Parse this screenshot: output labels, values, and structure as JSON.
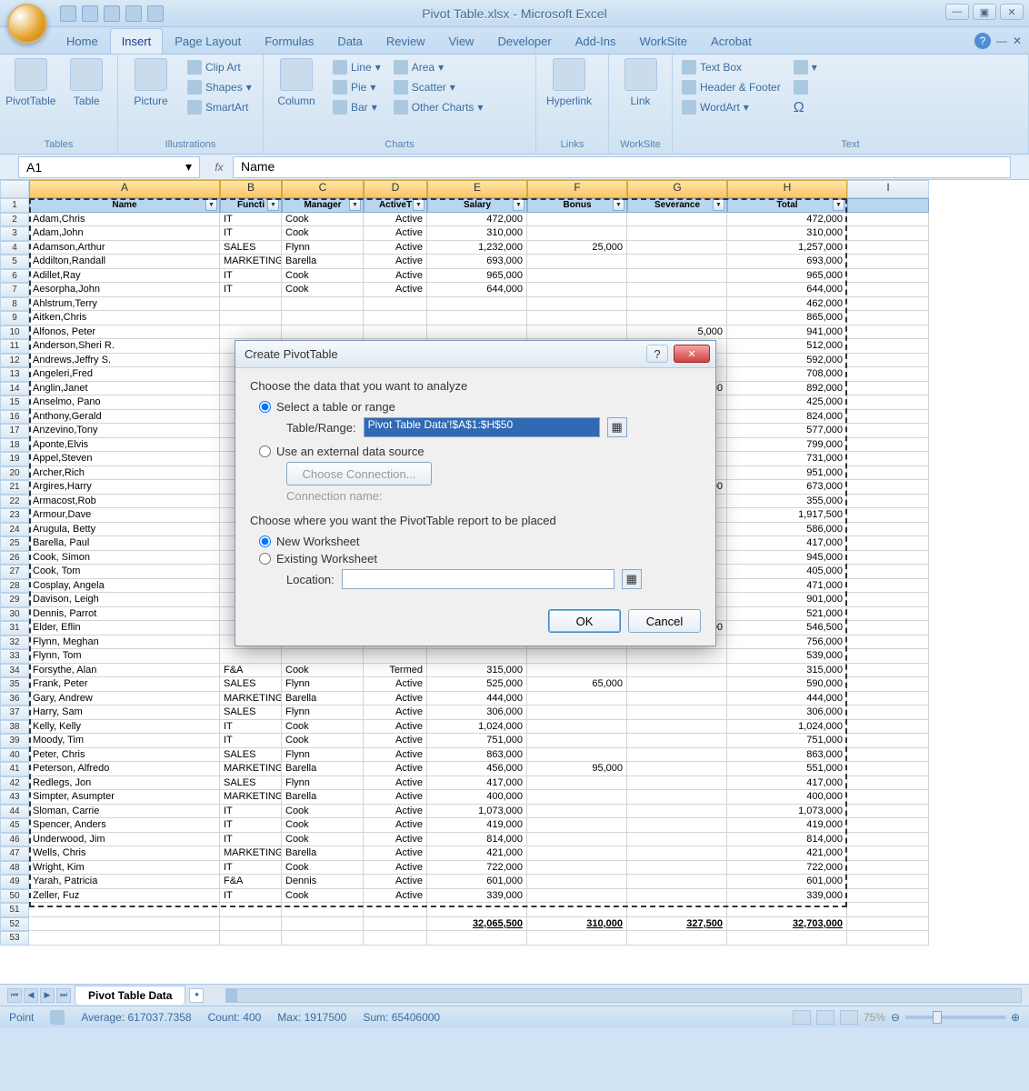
{
  "window": {
    "title": "Pivot Table.xlsx - Microsoft Excel"
  },
  "ribbon_tabs": [
    "Home",
    "Insert",
    "Page Layout",
    "Formulas",
    "Data",
    "Review",
    "View",
    "Developer",
    "Add-Ins",
    "WorkSite",
    "Acrobat"
  ],
  "ribbon": {
    "tables": {
      "pivot": "PivotTable",
      "table": "Table",
      "label": "Tables"
    },
    "illus": {
      "picture": "Picture",
      "clipart": "Clip Art",
      "shapes": "Shapes",
      "smartart": "SmartArt",
      "label": "Illustrations"
    },
    "charts": {
      "column": "Column",
      "line": "Line",
      "pie": "Pie",
      "bar": "Bar",
      "area": "Area",
      "scatter": "Scatter",
      "other": "Other Charts",
      "label": "Charts"
    },
    "links": {
      "hyperlink": "Hyperlink",
      "label": "Links"
    },
    "worksite": {
      "link": "Link",
      "label": "WorkSite"
    },
    "text": {
      "textbox": "Text Box",
      "header": "Header & Footer",
      "wordart": "WordArt",
      "label": "Text"
    }
  },
  "namebox": "A1",
  "fx": "fx",
  "formula": "Name",
  "columns": [
    "A",
    "B",
    "C",
    "D",
    "E",
    "F",
    "G",
    "H",
    "I"
  ],
  "headers": [
    "Name",
    "Functi",
    "Manager",
    "ActiveT",
    "Salary",
    "Bonus",
    "Severance",
    "Total"
  ],
  "rows": [
    {
      "n": "Adam,Chris",
      "f": "IT",
      "m": "Cook",
      "a": "Active",
      "s": "472,000",
      "b": "",
      "v": "",
      "t": "472,000"
    },
    {
      "n": "Adam,John",
      "f": "IT",
      "m": "Cook",
      "a": "Active",
      "s": "310,000",
      "b": "",
      "v": "",
      "t": "310,000"
    },
    {
      "n": "Adamson,Arthur",
      "f": "SALES",
      "m": "Flynn",
      "a": "Active",
      "s": "1,232,000",
      "b": "25,000",
      "v": "",
      "t": "1,257,000"
    },
    {
      "n": "Addilton,Randall",
      "f": "MARKETING",
      "m": "Barella",
      "a": "Active",
      "s": "693,000",
      "b": "",
      "v": "",
      "t": "693,000"
    },
    {
      "n": "Adillet,Ray",
      "f": "IT",
      "m": "Cook",
      "a": "Active",
      "s": "965,000",
      "b": "",
      "v": "",
      "t": "965,000"
    },
    {
      "n": "Aesorpha,John",
      "f": "IT",
      "m": "Cook",
      "a": "Active",
      "s": "644,000",
      "b": "",
      "v": "",
      "t": "644,000"
    },
    {
      "n": "Ahlstrum,Terry",
      "f": "",
      "m": "",
      "a": "",
      "s": "",
      "b": "",
      "v": "",
      "t": "462,000"
    },
    {
      "n": "Aitken,Chris",
      "f": "",
      "m": "",
      "a": "",
      "s": "",
      "b": "",
      "v": "",
      "t": "865,000"
    },
    {
      "n": "Alfonos, Peter",
      "f": "",
      "m": "",
      "a": "",
      "s": "",
      "b": "",
      "v": "5,000",
      "t": "941,000"
    },
    {
      "n": "Anderson,Sheri R.",
      "f": "",
      "m": "",
      "a": "",
      "s": "",
      "b": "",
      "v": "",
      "t": "512,000"
    },
    {
      "n": "Andrews,Jeffry S.",
      "f": "",
      "m": "",
      "a": "",
      "s": "",
      "b": "",
      "v": "",
      "t": "592,000"
    },
    {
      "n": "Angeleri,Fred",
      "f": "",
      "m": "",
      "a": "",
      "s": "",
      "b": "",
      "v": "",
      "t": "708,000"
    },
    {
      "n": "Anglin,Janet",
      "f": "",
      "m": "",
      "a": "",
      "s": "",
      "b": "",
      "v": "0,000",
      "t": "892,000"
    },
    {
      "n": "Anselmo, Pano",
      "f": "",
      "m": "",
      "a": "",
      "s": "",
      "b": "",
      "v": "",
      "t": "425,000"
    },
    {
      "n": "Anthony,Gerald",
      "f": "",
      "m": "",
      "a": "",
      "s": "",
      "b": "",
      "v": "",
      "t": "824,000"
    },
    {
      "n": "Anzevino,Tony",
      "f": "",
      "m": "",
      "a": "",
      "s": "",
      "b": "",
      "v": "",
      "t": "577,000"
    },
    {
      "n": "Aponte,Elvis",
      "f": "",
      "m": "",
      "a": "",
      "s": "",
      "b": "",
      "v": "",
      "t": "799,000"
    },
    {
      "n": "Appel,Steven",
      "f": "",
      "m": "",
      "a": "",
      "s": "",
      "b": "",
      "v": "",
      "t": "731,000"
    },
    {
      "n": "Archer,Rich",
      "f": "",
      "m": "",
      "a": "",
      "s": "",
      "b": "",
      "v": "",
      "t": "951,000"
    },
    {
      "n": "Argires,Harry",
      "f": "",
      "m": "",
      "a": "",
      "s": "",
      "b": "",
      "v": "0,000",
      "t": "673,000"
    },
    {
      "n": "Armacost,Rob",
      "f": "",
      "m": "",
      "a": "",
      "s": "",
      "b": "",
      "v": "",
      "t": "355,000"
    },
    {
      "n": "Armour,Dave",
      "f": "",
      "m": "",
      "a": "",
      "s": "",
      "b": "",
      "v": "",
      "t": "1,917,500"
    },
    {
      "n": "Arugula, Betty",
      "f": "",
      "m": "",
      "a": "",
      "s": "",
      "b": "",
      "v": "",
      "t": "586,000"
    },
    {
      "n": "Barella, Paul",
      "f": "",
      "m": "",
      "a": "",
      "s": "",
      "b": "",
      "v": "",
      "t": "417,000"
    },
    {
      "n": "Cook, Simon",
      "f": "",
      "m": "",
      "a": "",
      "s": "",
      "b": "",
      "v": "",
      "t": "945,000"
    },
    {
      "n": "Cook, Tom",
      "f": "",
      "m": "",
      "a": "",
      "s": "",
      "b": "",
      "v": "",
      "t": "405,000"
    },
    {
      "n": "Cosplay, Angela",
      "f": "",
      "m": "",
      "a": "",
      "s": "",
      "b": "",
      "v": "",
      "t": "471,000"
    },
    {
      "n": "Davison, Leigh",
      "f": "",
      "m": "",
      "a": "",
      "s": "",
      "b": "",
      "v": "",
      "t": "901,000"
    },
    {
      "n": "Dennis, Parrot",
      "f": "",
      "m": "",
      "a": "",
      "s": "",
      "b": "",
      "v": "",
      "t": "521,000"
    },
    {
      "n": "Elder, Eflin",
      "f": "",
      "m": "",
      "a": "",
      "s": "",
      "b": "",
      "v": "2,500",
      "t": "546,500"
    },
    {
      "n": "Flynn, Meghan",
      "f": "",
      "m": "",
      "a": "",
      "s": "",
      "b": "",
      "v": "",
      "t": "756,000"
    },
    {
      "n": "Flynn, Tom",
      "f": "",
      "m": "",
      "a": "",
      "s": "",
      "b": "",
      "v": "",
      "t": "539,000"
    },
    {
      "n": "Forsythe, Alan",
      "f": "F&A",
      "m": "Cook",
      "a": "Termed",
      "s": "315,000",
      "b": "",
      "v": "",
      "t": "315,000"
    },
    {
      "n": "Frank, Peter",
      "f": "SALES",
      "m": "Flynn",
      "a": "Active",
      "s": "525,000",
      "b": "65,000",
      "v": "",
      "t": "590,000"
    },
    {
      "n": "Gary, Andrew",
      "f": "MARKETING",
      "m": "Barella",
      "a": "Active",
      "s": "444,000",
      "b": "",
      "v": "",
      "t": "444,000"
    },
    {
      "n": "Harry, Sam",
      "f": "SALES",
      "m": "Flynn",
      "a": "Active",
      "s": "306,000",
      "b": "",
      "v": "",
      "t": "306,000"
    },
    {
      "n": "Kelly, Kelly",
      "f": "IT",
      "m": "Cook",
      "a": "Active",
      "s": "1,024,000",
      "b": "",
      "v": "",
      "t": "1,024,000"
    },
    {
      "n": "Moody, Tim",
      "f": "IT",
      "m": "Cook",
      "a": "Active",
      "s": "751,000",
      "b": "",
      "v": "",
      "t": "751,000"
    },
    {
      "n": "Peter, Chris",
      "f": "SALES",
      "m": "Flynn",
      "a": "Active",
      "s": "863,000",
      "b": "",
      "v": "",
      "t": "863,000"
    },
    {
      "n": "Peterson, Alfredo",
      "f": "MARKETING",
      "m": "Barella",
      "a": "Active",
      "s": "456,000",
      "b": "95,000",
      "v": "",
      "t": "551,000"
    },
    {
      "n": "Redlegs, Jon",
      "f": "SALES",
      "m": "Flynn",
      "a": "Active",
      "s": "417,000",
      "b": "",
      "v": "",
      "t": "417,000"
    },
    {
      "n": "Simpter, Asumpter",
      "f": "MARKETING",
      "m": "Barella",
      "a": "Active",
      "s": "400,000",
      "b": "",
      "v": "",
      "t": "400,000"
    },
    {
      "n": "Sloman, Carrie",
      "f": "IT",
      "m": "Cook",
      "a": "Active",
      "s": "1,073,000",
      "b": "",
      "v": "",
      "t": "1,073,000"
    },
    {
      "n": "Spencer, Anders",
      "f": "IT",
      "m": "Cook",
      "a": "Active",
      "s": "419,000",
      "b": "",
      "v": "",
      "t": "419,000"
    },
    {
      "n": "Underwood, Jim",
      "f": "IT",
      "m": "Cook",
      "a": "Active",
      "s": "814,000",
      "b": "",
      "v": "",
      "t": "814,000"
    },
    {
      "n": "Wells, Chris",
      "f": "MARKETING",
      "m": "Barella",
      "a": "Active",
      "s": "421,000",
      "b": "",
      "v": "",
      "t": "421,000"
    },
    {
      "n": "Wright, Kim",
      "f": "IT",
      "m": "Cook",
      "a": "Active",
      "s": "722,000",
      "b": "",
      "v": "",
      "t": "722,000"
    },
    {
      "n": "Yarah, Patricia",
      "f": "F&A",
      "m": "Dennis",
      "a": "Active",
      "s": "601,000",
      "b": "",
      "v": "",
      "t": "601,000"
    },
    {
      "n": "Zeller, Fuz",
      "f": "IT",
      "m": "Cook",
      "a": "Active",
      "s": "339,000",
      "b": "",
      "v": "",
      "t": "339,000"
    }
  ],
  "totals": {
    "salary": "32,065,500",
    "bonus": "310,000",
    "severance": "327,500",
    "total": "32,703,000"
  },
  "dialog": {
    "title": "Create PivotTable",
    "choose_data": "Choose the data that you want to analyze",
    "select_range": "Select a table or range",
    "table_range_label": "Table/Range:",
    "table_range_value": "Pivot Table Data'!$A$1:$H$50",
    "external": "Use an external data source",
    "choose_conn": "Choose Connection...",
    "conn_name": "Connection name:",
    "choose_where": "Choose where you want the PivotTable report to be placed",
    "new_ws": "New Worksheet",
    "existing_ws": "Existing Worksheet",
    "location_label": "Location:",
    "ok": "OK",
    "cancel": "Cancel"
  },
  "sheet_tab": "Pivot Table Data",
  "status": {
    "mode": "Point",
    "avg": "Average: 617037.7358",
    "count": "Count: 400",
    "max": "Max: 1917500",
    "sum": "Sum: 65406000",
    "zoom": "75%"
  }
}
